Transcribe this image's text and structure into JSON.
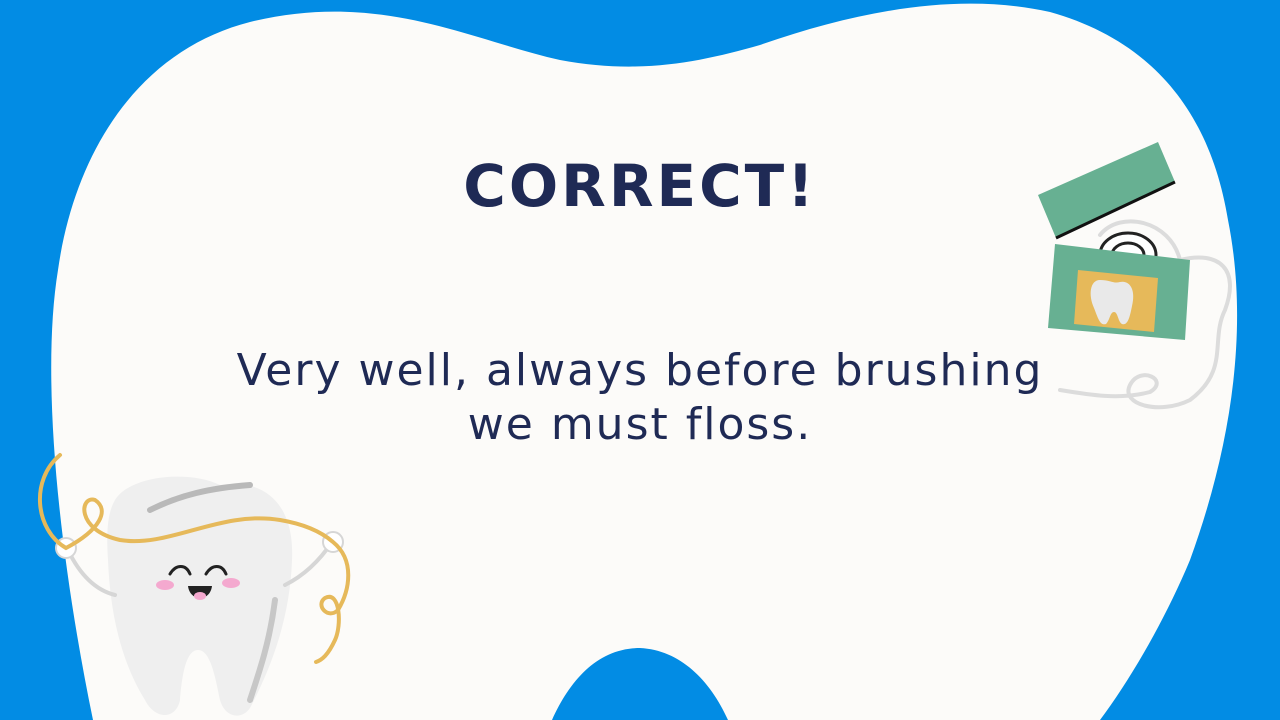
{
  "slide": {
    "title": "CORRECT!",
    "message_line1": "Very well, always before brushing",
    "message_line2": "we must floss."
  },
  "colors": {
    "background": "#028ce4",
    "tooth_shape": "#fcfbf9",
    "text": "#1f2a55",
    "floss_box": "#67b092",
    "floss_label": "#e6b95a",
    "floss_string": "#e6b95a"
  },
  "icons": [
    "tooth-background-shape",
    "floss-box-icon",
    "smiling-tooth-icon"
  ]
}
